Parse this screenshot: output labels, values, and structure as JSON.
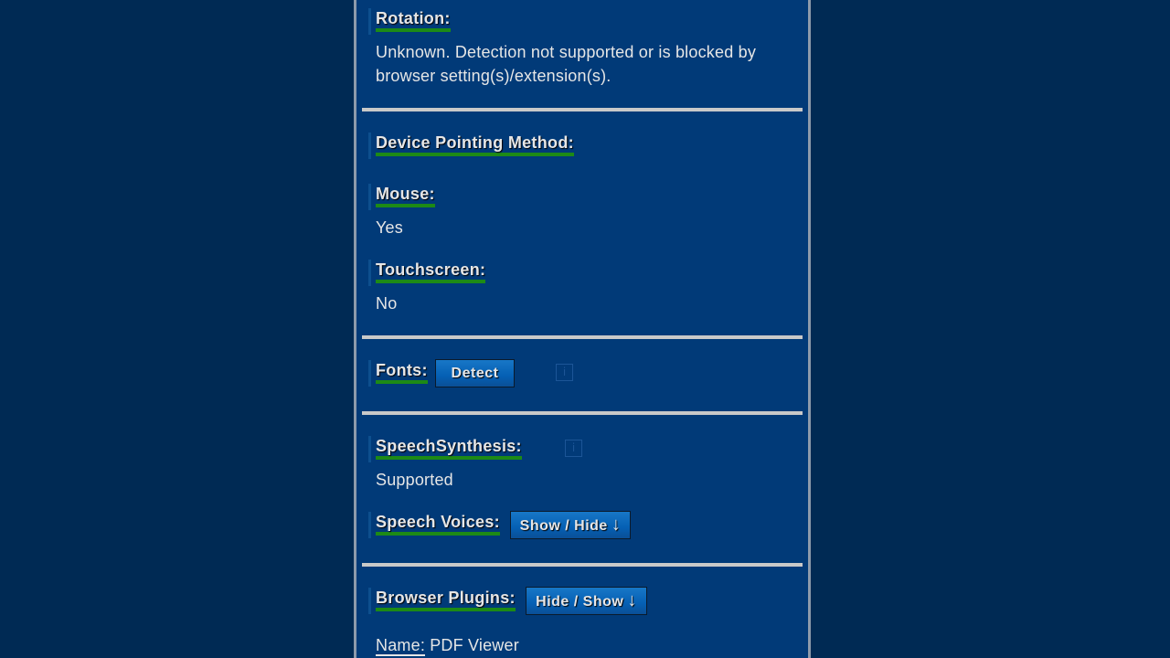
{
  "rotation": {
    "label": "Rotation:",
    "value": "Unknown. Detection not supported or is blocked by browser setting(s)/extension(s)."
  },
  "pointing": {
    "label": "Device Pointing Method:",
    "mouse_label": "Mouse:",
    "mouse_value": "Yes",
    "touch_label": "Touchscreen:",
    "touch_value": "No"
  },
  "fonts": {
    "label": "Fonts:",
    "button": "Detect",
    "info_icon": "i"
  },
  "speech": {
    "label": "SpeechSynthesis:",
    "value": "Supported",
    "info_icon": "i",
    "voices_label": "Speech Voices:",
    "voices_button": "Show / Hide",
    "voices_arrow": "↓"
  },
  "plugins": {
    "label": "Browser Plugins:",
    "button": "Hide / Show",
    "arrow": "↓",
    "name_label": "Name:",
    "name_value": "PDF Viewer"
  },
  "colors": {
    "page_bg": "#002a54",
    "panel_bg": "#013a78",
    "underline_green": "#1d8a16",
    "button_blue": "#0560b4",
    "divider": "#c9c9c9"
  }
}
